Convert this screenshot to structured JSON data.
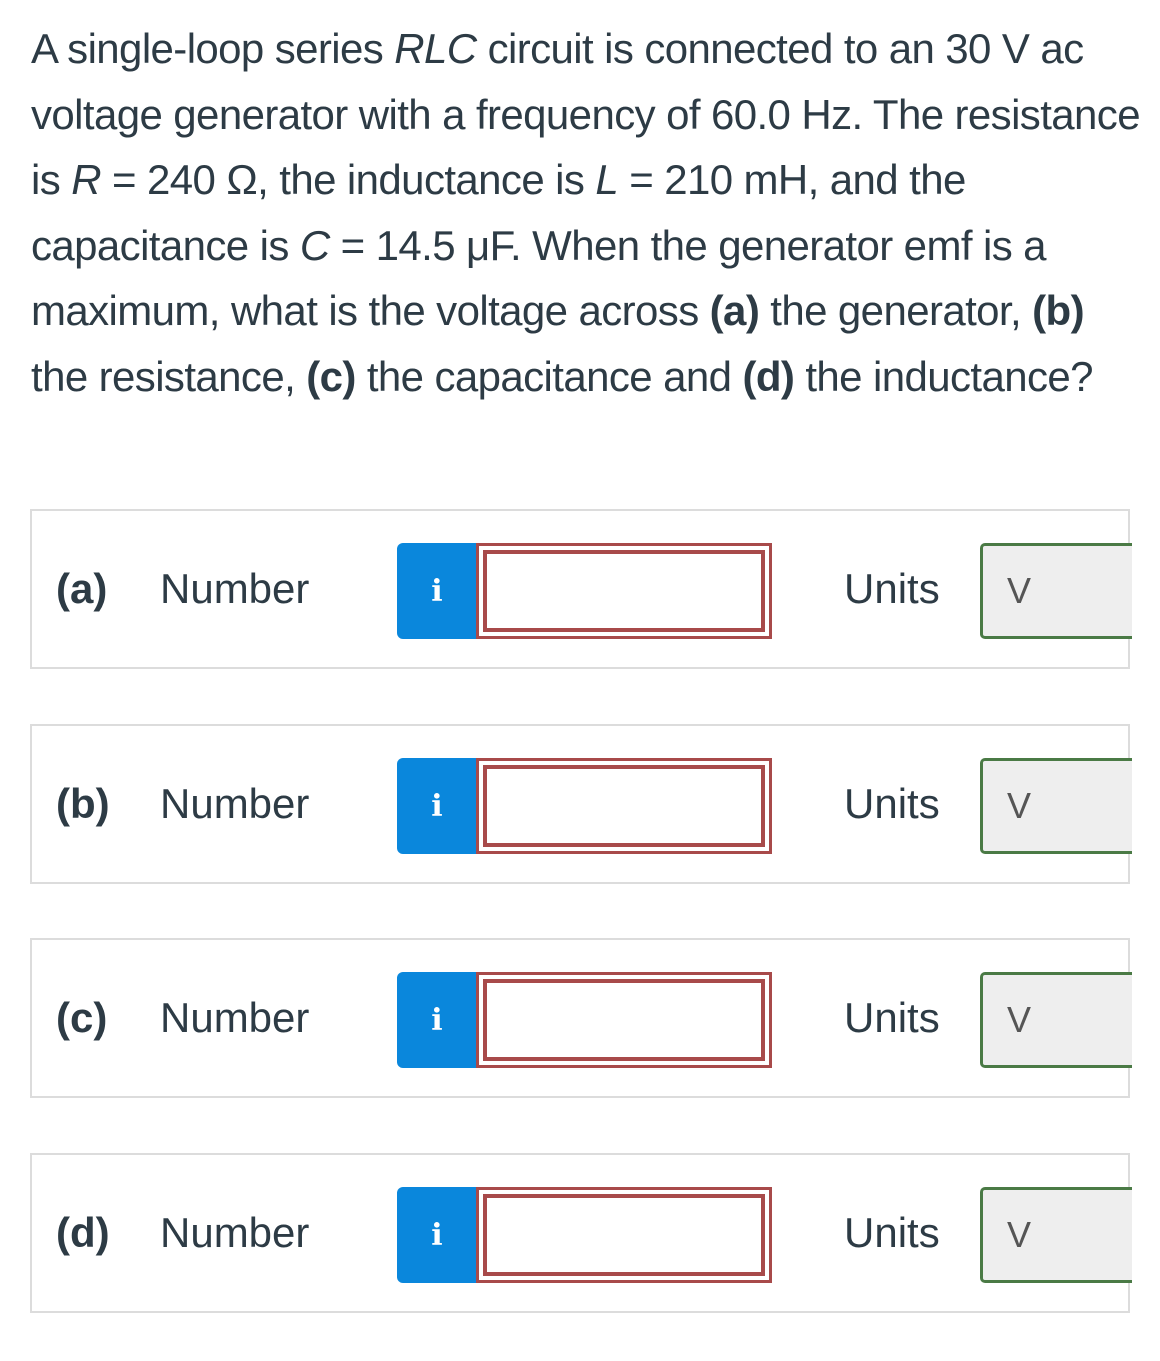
{
  "question": {
    "segments": [
      {
        "text": "A single-loop series ",
        "style": "normal"
      },
      {
        "text": "RLC",
        "style": "italic"
      },
      {
        "text": " circuit is connected to an 30 V ac voltage generator with a frequency of 60.0 Hz. The resistance is ",
        "style": "normal"
      },
      {
        "text": "R",
        "style": "italic"
      },
      {
        "text": " = 240 Ω, the inductance is ",
        "style": "normal"
      },
      {
        "text": "L",
        "style": "italic"
      },
      {
        "text": " = 210 mH, and the capacitance is ",
        "style": "normal"
      },
      {
        "text": "C",
        "style": "italic"
      },
      {
        "text": " = 14.5 μF. When the generator emf is a maximum, what is the voltage across ",
        "style": "normal"
      },
      {
        "text": "(a)",
        "style": "bold"
      },
      {
        "text": " the generator, ",
        "style": "normal"
      },
      {
        "text": "(b)",
        "style": "bold"
      },
      {
        "text": " the resistance, ",
        "style": "normal"
      },
      {
        "text": "(c)",
        "style": "bold"
      },
      {
        "text": " the capacitance and ",
        "style": "normal"
      },
      {
        "text": "(d)",
        "style": "bold"
      },
      {
        "text": " the inductance?",
        "style": "normal"
      }
    ]
  },
  "parts": [
    {
      "label": "(a)",
      "number_label": "Number",
      "info_icon": "i",
      "answer_value": "",
      "units_label": "Units",
      "units_value": "V"
    },
    {
      "label": "(b)",
      "number_label": "Number",
      "info_icon": "i",
      "answer_value": "",
      "units_label": "Units",
      "units_value": "V"
    },
    {
      "label": "(c)",
      "number_label": "Number",
      "info_icon": "i",
      "answer_value": "",
      "units_label": "Units",
      "units_value": "V"
    },
    {
      "label": "(d)",
      "number_label": "Number",
      "info_icon": "i",
      "answer_value": "",
      "units_label": "Units",
      "units_value": "V"
    }
  ],
  "colors": {
    "text": "#2d3b45",
    "info_button": "#0a87dc",
    "answer_border_error": "#a84a4a",
    "units_border": "#4a7a45",
    "units_bg": "#eeeeee",
    "card_border": "#dcdcdc"
  }
}
